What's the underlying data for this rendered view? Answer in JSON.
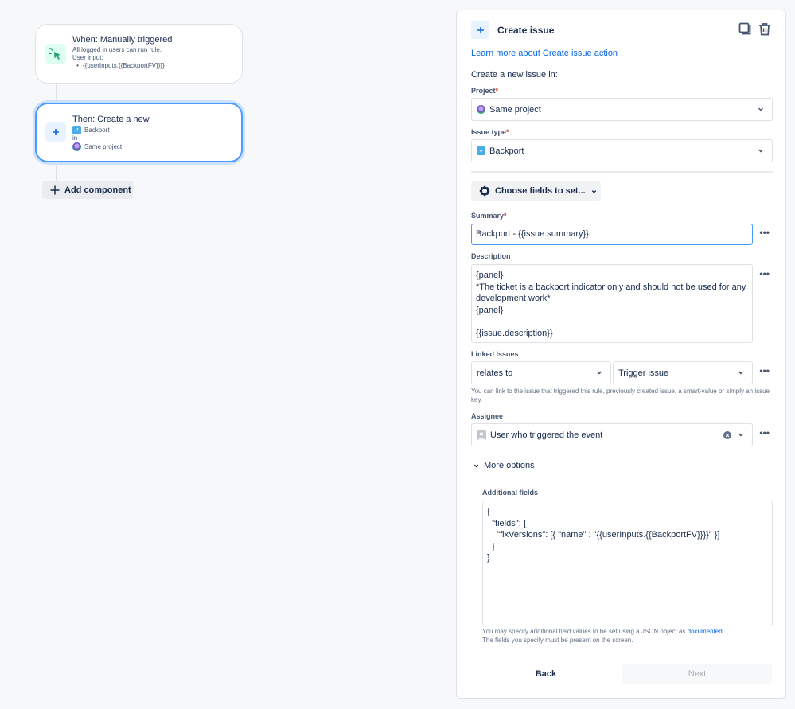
{
  "canvas": {
    "trigger": {
      "title": "When: Manually triggered",
      "line1": "All logged in users can run rule.",
      "line2": "User input:",
      "bullet_dot": "•",
      "bullet": "{{userInputs.{{BackportFV}}}}",
      "icon": "cursor-click-icon"
    },
    "action": {
      "title": "Then: Create a new",
      "issue_type": "Backport",
      "in_label": "in",
      "project": "Same project",
      "icon": "plus-icon"
    },
    "add_component_label": "Add component"
  },
  "panel": {
    "title": "Create issue",
    "learn_more": "Learn more about Create issue action",
    "create_in": "Create a new issue in:",
    "project": {
      "label": "Project",
      "required": "*",
      "value": "Same project"
    },
    "issue_type": {
      "label": "Issue type",
      "required": "*",
      "value": "Backport"
    },
    "choose_fields_label": "Choose fields to set...",
    "summary": {
      "label": "Summary",
      "required": "*",
      "value": "Backport - {{issue.summary}}"
    },
    "description": {
      "label": "Description",
      "value": "{panel}\n*The ticket is a backport indicator only and should not be used for any\ndevelopment work*\n{panel}\n\n{{issue.description}}"
    },
    "linked_issues": {
      "label": "Linked Issues",
      "link_type": "relates to",
      "target": "Trigger issue",
      "helper": "You can link to the issue that triggered this rule, previously created issue, a smart-value or simply an issue key."
    },
    "assignee": {
      "label": "Assignee",
      "value": "User who triggered the event"
    },
    "more_options_label": "More options",
    "additional_fields": {
      "label": "Additional fields",
      "value": "{\n  \"fields\": {\n    \"fixVersions\": [{ \"name\" : \"{{userInputs.{{BackportFV}}}}\" }]\n  }\n}",
      "helper_prefix": "You may specify additional field values to be set using a JSON object as ",
      "helper_link": "documented",
      "helper_suffix": ".",
      "helper_line2": "The fields you specify must be present on the screen."
    },
    "more_dots": "•••",
    "back_label": "Back",
    "next_label": "Next"
  },
  "colors": {
    "accent": "#0c66e4",
    "focus_border": "#4c9aff",
    "required": "#c9372c",
    "trigger_icon_bg": "#dcfff1",
    "trigger_icon": "#22a06b"
  }
}
